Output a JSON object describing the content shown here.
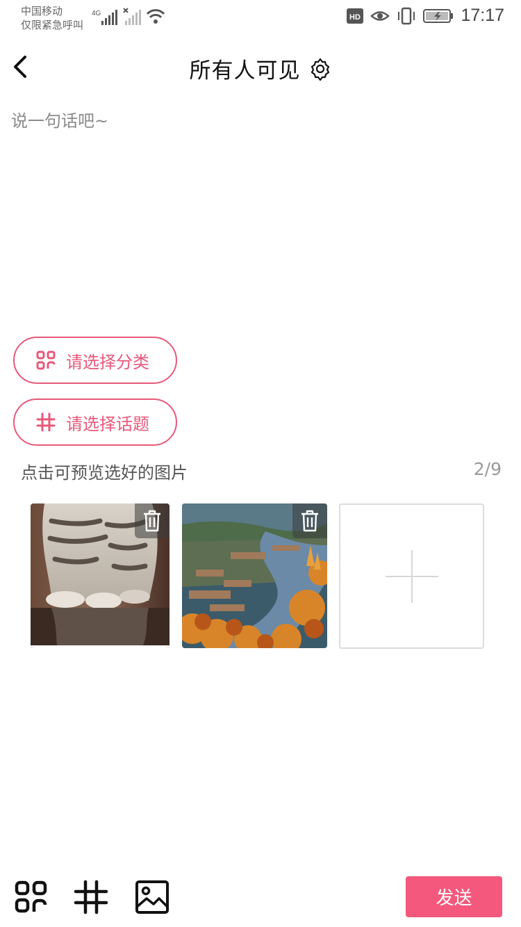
{
  "status_bar": {
    "carrier_line1": "中国移动",
    "carrier_line2": "仅限紧急呼叫",
    "network": "4G",
    "hd_badge": "HD",
    "time": "17:17"
  },
  "header": {
    "title": "所有人可见",
    "back_icon": "chevron-left-icon",
    "settings_icon": "gear-icon"
  },
  "composer": {
    "placeholder": "说一句话吧~",
    "value": ""
  },
  "category_button": {
    "label": "请选择分类",
    "icon": "category-grid-icon"
  },
  "topic_button": {
    "label": "请选择话题",
    "icon": "hashtag-icon"
  },
  "images": {
    "hint": "点击可预览选好的图片",
    "count": "2/9",
    "items": [
      {
        "subject": "tabby kitten"
      },
      {
        "subject": "autumn village by river"
      }
    ],
    "add_icon": "plus-icon",
    "delete_icon": "trash-icon"
  },
  "toolbar": {
    "tools": [
      "category-grid-icon",
      "hashtag-icon",
      "image-icon"
    ],
    "send_label": "发送"
  },
  "colors": {
    "accent": "#e8587a",
    "send_bg": "#f4587c",
    "placeholder": "#8a8a8a"
  }
}
